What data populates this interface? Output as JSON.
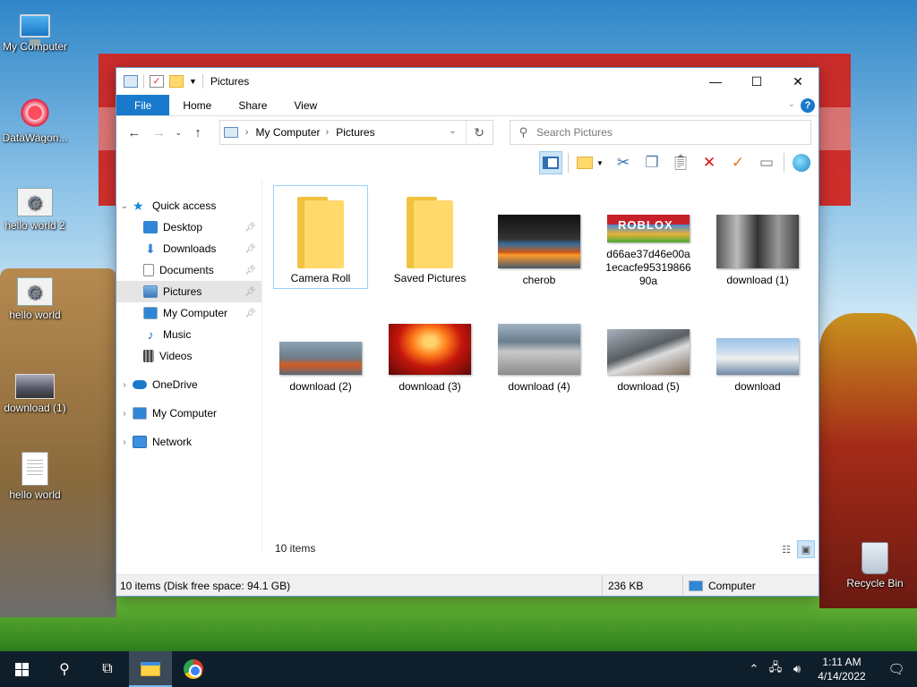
{
  "desktop": {
    "icons": [
      {
        "label": "My Computer"
      },
      {
        "label": "DataWagon..."
      },
      {
        "label": "hello world 2"
      },
      {
        "label": "hello world"
      },
      {
        "label": "download (1)"
      },
      {
        "label": "hello world"
      },
      {
        "label": "Recycle Bin"
      }
    ]
  },
  "window": {
    "title": "Pictures",
    "tabs": [
      "File",
      "Home",
      "Share",
      "View"
    ],
    "help_label": "?",
    "address": {
      "crumbs": [
        "My Computer",
        "Pictures"
      ]
    },
    "search": {
      "placeholder": "Search Pictures"
    },
    "nav": [
      {
        "label": "Quick access"
      },
      {
        "label": "Desktop"
      },
      {
        "label": "Downloads"
      },
      {
        "label": "Documents"
      },
      {
        "label": "Pictures"
      },
      {
        "label": "My Computer"
      },
      {
        "label": "Music"
      },
      {
        "label": "Videos"
      },
      {
        "label": "OneDrive"
      },
      {
        "label": "My Computer"
      },
      {
        "label": "Network"
      }
    ],
    "files": [
      {
        "name": "Camera Roll",
        "type": "folder"
      },
      {
        "name": "Saved Pictures",
        "type": "folder"
      },
      {
        "name": "cherob",
        "type": "image"
      },
      {
        "name": "d66ae37d46e00a1ecacfe9531986690a",
        "type": "image"
      },
      {
        "name": "download (1)",
        "type": "image"
      },
      {
        "name": "download (2)",
        "type": "image"
      },
      {
        "name": "download (3)",
        "type": "image"
      },
      {
        "name": "download (4)",
        "type": "image"
      },
      {
        "name": "download (5)",
        "type": "image"
      },
      {
        "name": "download",
        "type": "image"
      }
    ],
    "item_count": "10 items",
    "status": {
      "info": "10 items (Disk free space: 94.1 GB)",
      "size": "236 KB",
      "location": "Computer"
    }
  },
  "taskbar": {
    "time": "1:11 AM",
    "date": "4/14/2022"
  },
  "colors": {
    "accent": "#1979ca",
    "selection": "#cce4f7",
    "taskbar": "#0f1e2b"
  }
}
